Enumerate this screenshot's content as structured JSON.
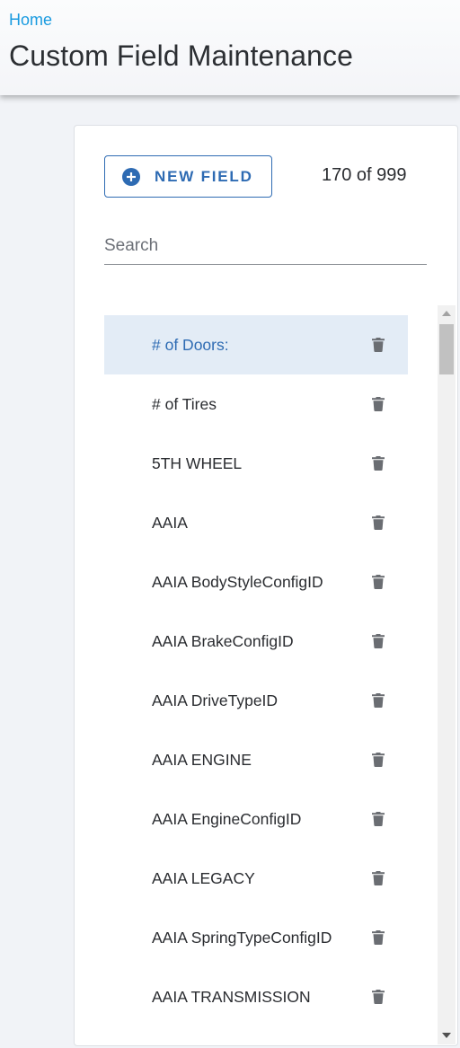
{
  "header": {
    "breadcrumb": "Home",
    "title": "Custom Field Maintenance"
  },
  "toolbar": {
    "new_field_label": "NEW FIELD",
    "count": "170 of 999"
  },
  "search": {
    "placeholder": "Search",
    "value": ""
  },
  "colors": {
    "accent": "#2e6bb3",
    "link": "#1a9be0",
    "selected_bg": "#e3ecf6"
  },
  "fields": [
    {
      "label": "# of Doors:",
      "selected": true
    },
    {
      "label": "# of Tires"
    },
    {
      "label": "5TH WHEEL"
    },
    {
      "label": "AAIA"
    },
    {
      "label": "AAIA BodyStyleConfigID"
    },
    {
      "label": "AAIA BrakeConfigID"
    },
    {
      "label": "AAIA DriveTypeID"
    },
    {
      "label": "AAIA ENGINE"
    },
    {
      "label": "AAIA EngineConfigID"
    },
    {
      "label": "AAIA LEGACY"
    },
    {
      "label": "AAIA SpringTypeConfigID"
    },
    {
      "label": "AAIA TRANSMISSION"
    }
  ],
  "icons": {
    "new_field": "plus-circle-icon",
    "delete": "trash-icon"
  }
}
